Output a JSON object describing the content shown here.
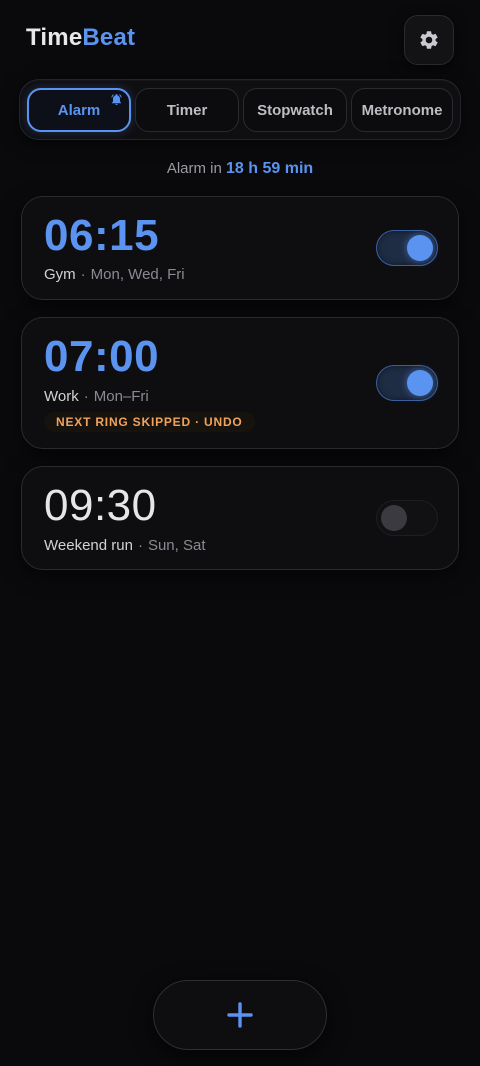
{
  "app": {
    "title_part1": "Time",
    "title_part2": "Beat"
  },
  "header": {
    "settings_icon": "gear-icon"
  },
  "tabs": [
    {
      "label": "Alarm",
      "active": true,
      "icon": "bell-icon"
    },
    {
      "label": "Timer",
      "active": false
    },
    {
      "label": "Stopwatch",
      "active": false
    },
    {
      "label": "Metronome",
      "active": false
    }
  ],
  "next_alarm": {
    "prefix": "Alarm in",
    "value": "18 h 59 min"
  },
  "alarms": [
    {
      "time": "06:15",
      "label": "Gym",
      "separator": "·",
      "days": "Mon, Wed, Fri",
      "enabled": true
    },
    {
      "time": "07:00",
      "label": "Work",
      "separator": "·",
      "days": "Mon–Fri",
      "enabled": true,
      "notice": "NEXT RING SKIPPED · UNDO"
    },
    {
      "time": "09:30",
      "label": "Weekend run",
      "separator": "·",
      "days": "Sun, Sat",
      "enabled": false
    }
  ],
  "fab": {
    "icon": "plus-icon"
  },
  "colors": {
    "accent": "#5b93f0",
    "warning": "#f0a35c",
    "background": "#0a0a0c"
  }
}
